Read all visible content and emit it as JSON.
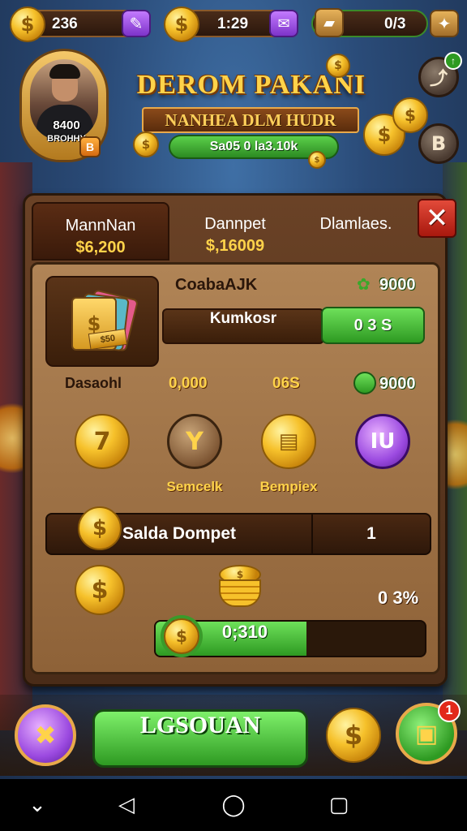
{
  "topbar": {
    "coins_value": "236",
    "coins2_value": "1:29",
    "progress_value": "0/3"
  },
  "profile": {
    "level_text": "8400",
    "sub_text": "BROHHY",
    "badge_text": "B"
  },
  "title": {
    "main": "DEROM PAKANI",
    "sub": "NANHEA DLM HUDR",
    "tag": "Sa05 0 la3.10k"
  },
  "side_buttons": {
    "b_label": "B"
  },
  "tabs": [
    {
      "label": "MannNan",
      "value": "$6,200"
    },
    {
      "label": "Dannpet",
      "value": "$,16009"
    },
    {
      "label": "Dlamlaes."
    }
  ],
  "close_label": "✕",
  "cash_card": {
    "name": "CoabaAJK",
    "reward": "9000",
    "field_label": "Kumkosr",
    "button_label": "0 3 S"
  },
  "stats": {
    "label": "Dasaohl",
    "value1": "0,000",
    "value2": "06S",
    "reward": "9000"
  },
  "icons": [
    {
      "glyph": "7",
      "caption": ""
    },
    {
      "glyph": "Y",
      "caption": "Semcelk"
    },
    {
      "glyph": "",
      "caption": "Bempiex"
    },
    {
      "glyph": "IU",
      "caption": ""
    }
  ],
  "saldo": {
    "label": "Salda Dompet",
    "count": "1"
  },
  "progress": {
    "percent_text": "0 3%",
    "bar_text": "0;310",
    "fill_fraction": 0.56
  },
  "bottom": {
    "play_label": "LGSOUAN",
    "notif_count": "1"
  },
  "colors": {
    "gold": "#ffd34a",
    "green": "#2e9a22",
    "panel": "#6a4226",
    "purple": "#9b4ae0"
  }
}
